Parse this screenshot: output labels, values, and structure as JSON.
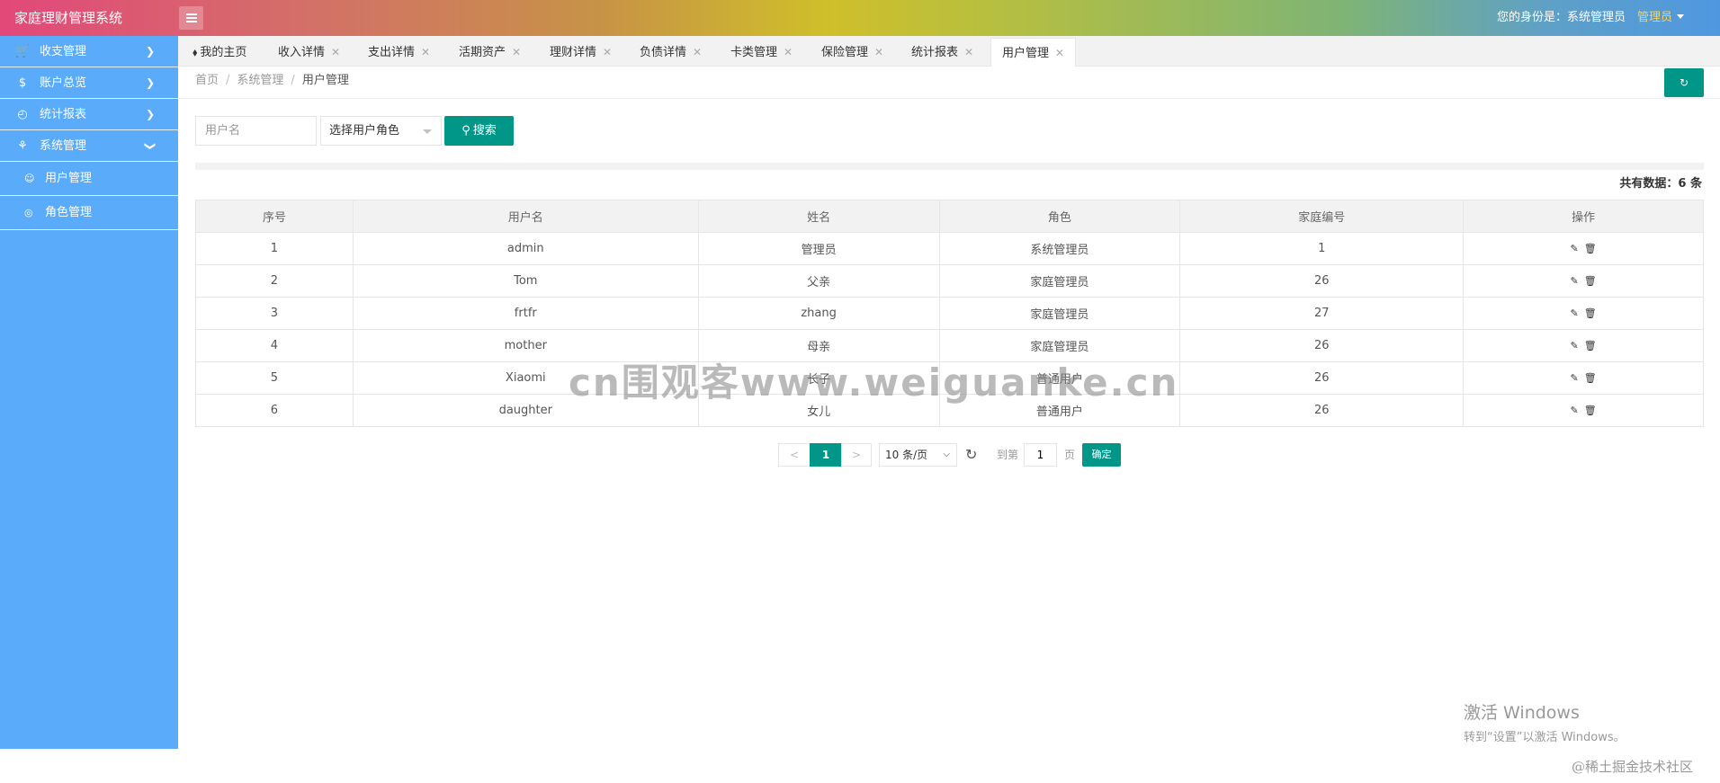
{
  "header": {
    "title": "家庭理财管理系统",
    "identity": "您的身份是：系统管理员",
    "user_menu": "管理员"
  },
  "sidebar": {
    "items": [
      {
        "label": "收支管理",
        "icon": "cart-icon"
      },
      {
        "label": "账户总览",
        "icon": "dollar-icon"
      },
      {
        "label": "统计报表",
        "icon": "chart-icon"
      },
      {
        "label": "系统管理",
        "icon": "apps-icon"
      }
    ],
    "sub_items": [
      {
        "label": "用户管理",
        "icon": "user-icon"
      },
      {
        "label": "角色管理",
        "icon": "role-icon"
      }
    ]
  },
  "tabs": [
    {
      "label": "我的主页"
    },
    {
      "label": "收入详情"
    },
    {
      "label": "支出详情"
    },
    {
      "label": "活期资产"
    },
    {
      "label": "理财详情"
    },
    {
      "label": "负债详情"
    },
    {
      "label": "卡类管理"
    },
    {
      "label": "保险管理"
    },
    {
      "label": "统计报表"
    },
    {
      "label": "用户管理"
    }
  ],
  "breadcrumb": {
    "home": "首页",
    "section": "系统管理",
    "current": "用户管理"
  },
  "search": {
    "username_placeholder": "用户名",
    "role_placeholder": "选择用户角色",
    "button": "搜索"
  },
  "total_text": "共有数据：6 条",
  "table": {
    "columns": [
      "序号",
      "用户名",
      "姓名",
      "角色",
      "家庭编号",
      "操作"
    ],
    "rows": [
      [
        "1",
        "admin",
        "管理员",
        "系统管理员",
        "1"
      ],
      [
        "2",
        "Tom",
        "父亲",
        "家庭管理员",
        "26"
      ],
      [
        "3",
        "frtfr",
        "zhang",
        "家庭管理员",
        "27"
      ],
      [
        "4",
        "mother",
        "母亲",
        "家庭管理员",
        "26"
      ],
      [
        "5",
        "Xiaomi",
        "长子",
        "普通用户",
        "26"
      ],
      [
        "6",
        "daughter",
        "女儿",
        "普通用户",
        "26"
      ]
    ]
  },
  "pager": {
    "prev": "<",
    "current": "1",
    "next": ">",
    "limit": "10 条/页",
    "goto_label": "到第",
    "goto_value": "1",
    "page_label": "页",
    "confirm": "确定"
  },
  "overlays": {
    "watermark": "cn围观客www.weiguanke.cn",
    "windows_line1": "激活 Windows",
    "windows_line2": "转到“设置”以激活 Windows。",
    "credit": "@稀土掘金技术社区"
  },
  "colors": {
    "sidebar": "#5aacfa",
    "primary": "#009688",
    "user_menu": "#ffd24d"
  }
}
